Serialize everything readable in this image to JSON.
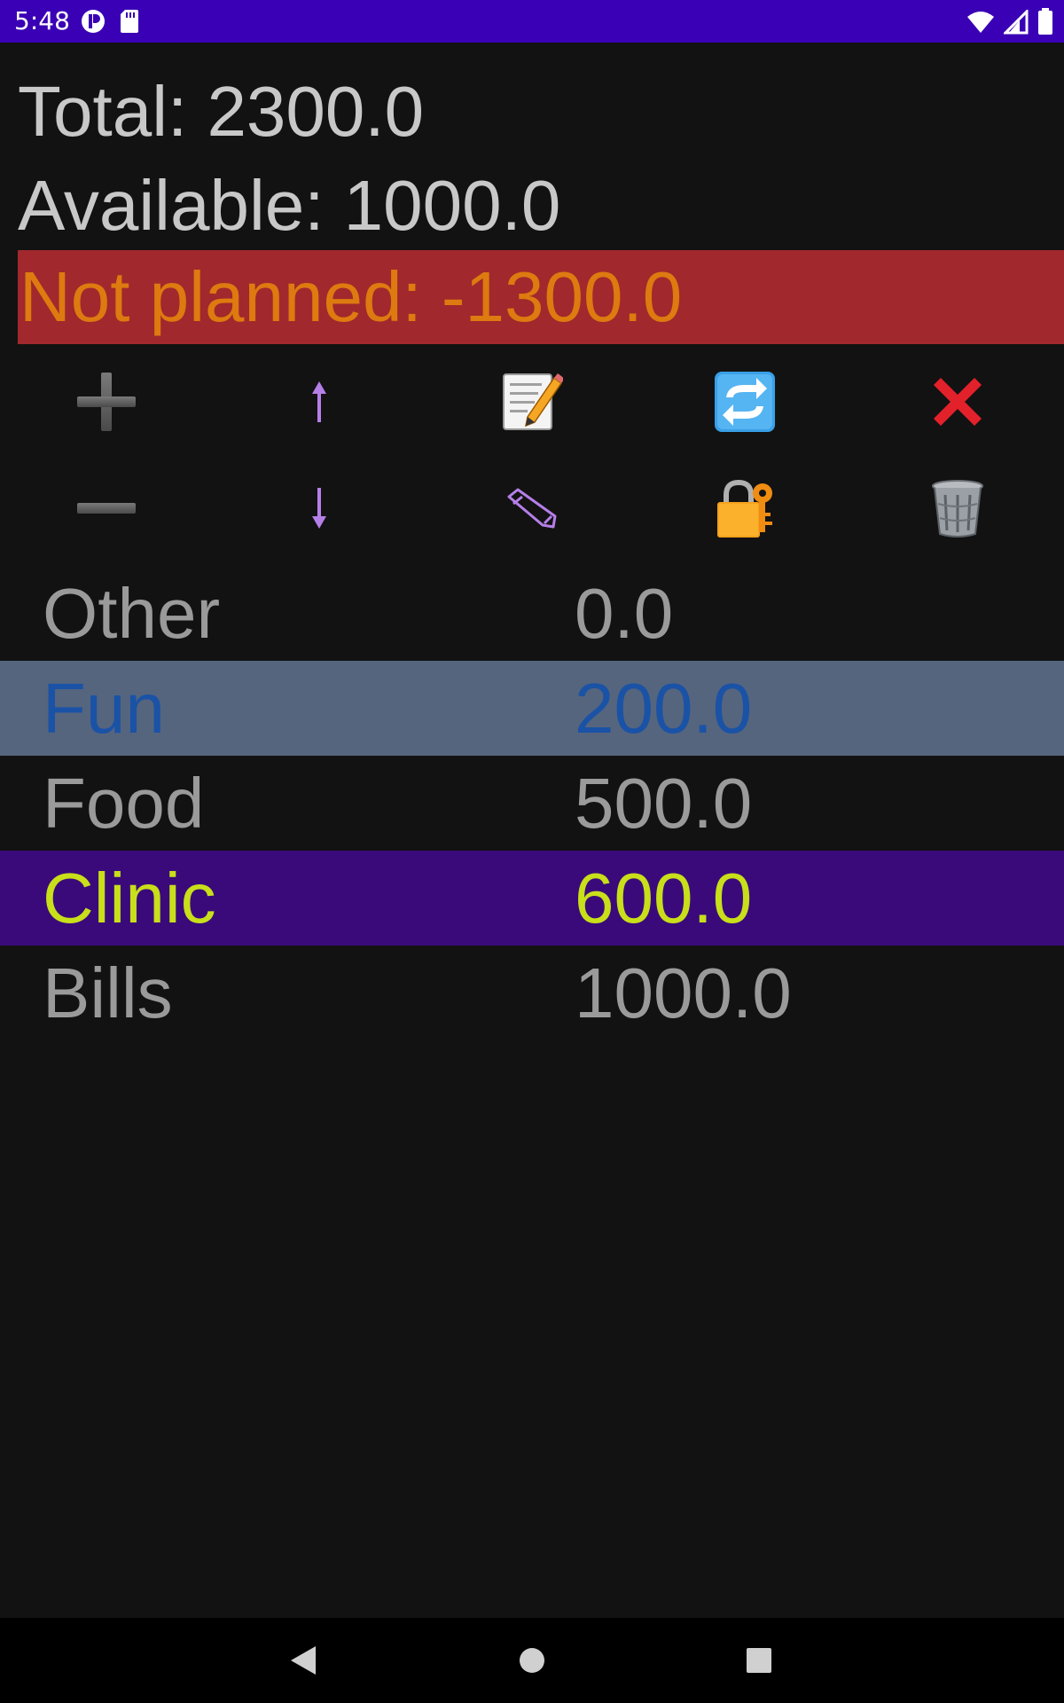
{
  "status_bar": {
    "time": "5:48",
    "background": "#3a00b5",
    "icons": [
      "notification-app-icon",
      "sd-card-icon",
      "wifi-icon",
      "signal-icon",
      "battery-icon"
    ]
  },
  "summary": {
    "total": "Total: 2300.0",
    "available": "Available: 1000.0",
    "not_planned": "Not planned: -1300.0",
    "not_planned_background": "#a1282c",
    "not_planned_color": "#dd7a10"
  },
  "toolbar": {
    "buttons": [
      {
        "icon": "plus-icon",
        "action": "add"
      },
      {
        "icon": "arrow-up-icon",
        "action": "move-up"
      },
      {
        "icon": "memo-icon",
        "action": "edit"
      },
      {
        "icon": "refresh-icon",
        "action": "refresh"
      },
      {
        "icon": "cross-icon",
        "action": "close"
      },
      {
        "icon": "minus-icon",
        "action": "remove"
      },
      {
        "icon": "arrow-down-icon",
        "action": "move-down"
      },
      {
        "icon": "pencil-icon",
        "action": "rename"
      },
      {
        "icon": "lock-key-icon",
        "action": "lock"
      },
      {
        "icon": "trash-icon",
        "action": "delete"
      }
    ]
  },
  "categories": [
    {
      "name": "Other",
      "amount": "0.0"
    },
    {
      "name": "Fun",
      "amount": "200.0",
      "highlight": "#55657e",
      "text_color": "#1a52a6"
    },
    {
      "name": "Food",
      "amount": "500.0"
    },
    {
      "name": "Clinic",
      "amount": "600.0",
      "highlight": "#3a0a7b",
      "text_color": "#c8df1a"
    },
    {
      "name": "Bills",
      "amount": "1000.0"
    }
  ],
  "nav_bar": {
    "buttons": [
      "back-icon",
      "home-icon",
      "recents-icon"
    ]
  }
}
